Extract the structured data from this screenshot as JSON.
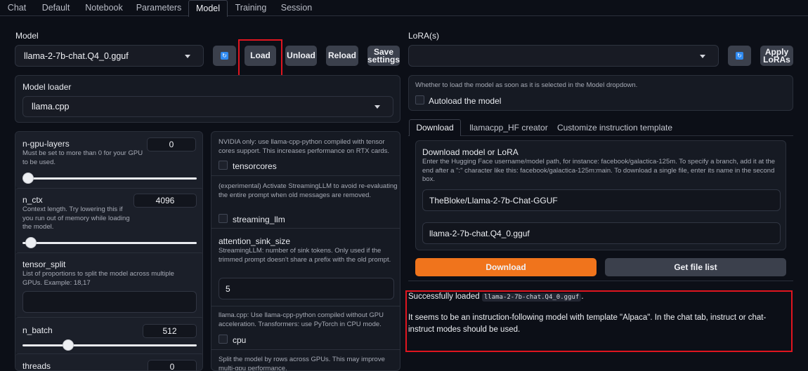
{
  "tabs": [
    "Chat",
    "Default",
    "Notebook",
    "Parameters",
    "Model",
    "Training",
    "Session"
  ],
  "active_tab": "Model",
  "model": {
    "label": "Model",
    "selected": "llama-2-7b-chat.Q4_0.gguf",
    "load_label": "Load",
    "unload_label": "Unload",
    "reload_label": "Reload",
    "save_label_1": "Save",
    "save_label_2": "settings"
  },
  "lora": {
    "label": "LoRA(s)",
    "selected": "",
    "apply_label_1": "Apply",
    "apply_label_2": "LoRAs"
  },
  "loader": {
    "label": "Model loader",
    "selected": "llama.cpp"
  },
  "params": {
    "n_gpu_layers": {
      "label": "n-gpu-layers",
      "value": "0",
      "info": "Must be set to more than 0 for your GPU to be used.",
      "fraction": 0.0
    },
    "n_ctx": {
      "label": "n_ctx",
      "value": "4096",
      "info": "Context length. Try lowering this if you run out of memory while loading the model.",
      "fraction": 0.03
    },
    "tensor_split": {
      "label": "tensor_split",
      "info": "List of proportions to split the model across multiple GPUs. Example: 18,17",
      "value": ""
    },
    "n_batch": {
      "label": "n_batch",
      "value": "512",
      "fraction": 0.25
    },
    "threads": {
      "label": "threads",
      "value": "0"
    }
  },
  "middle": {
    "tensorcores_info": "NVIDIA only: use llama-cpp-python compiled with tensor cores support. This increases performance on RTX cards.",
    "tensorcores_label": "tensorcores",
    "streaming_info": "(experimental) Activate StreamingLLM to avoid re-evaluating the entire prompt when old messages are removed.",
    "streaming_label": "streaming_llm",
    "sink_label": "attention_sink_size",
    "sink_info": "StreamingLLM: number of sink tokens. Only used if the trimmed prompt doesn't share a prefix with the old prompt.",
    "sink_value": "5",
    "cpu_info": "llama.cpp: Use llama-cpp-python compiled without GPU acceleration. Transformers: use PyTorch in CPU mode.",
    "cpu_label": "cpu",
    "split_info": "Split the model by rows across GPUs. This may improve multi-gpu performance."
  },
  "autoload": {
    "info": "Whether to load the model as soon as it is selected in the Model dropdown.",
    "label": "Autoload the model"
  },
  "subtabs": [
    "Download",
    "llamacpp_HF creator",
    "Customize instruction template"
  ],
  "download": {
    "title": "Download model or LoRA",
    "info": "Enter the Hugging Face username/model path, for instance: facebook/galactica-125m. To specify a branch, add it at the end after a \":\" character like this: facebook/galactica-125m:main. To download a single file, enter its name in the second box.",
    "repo_value": "TheBloke/Llama-2-7b-Chat-GGUF",
    "file_value": "llama-2-7b-chat.Q4_0.gguf",
    "download_label": "Download",
    "getfiles_label": "Get file list"
  },
  "status": {
    "prefix": "Successfully loaded",
    "model_code": "llama-2-7b-chat.Q4_0.gguf",
    "suffix": ".",
    "message": "It seems to be an instruction-following model with template \"Alpaca\". In the chat tab, instruct or chat-instruct modes should be used."
  },
  "colors": {
    "accent": "#f0741c",
    "highlight": "#e0151f",
    "background": "#0c0f17"
  }
}
